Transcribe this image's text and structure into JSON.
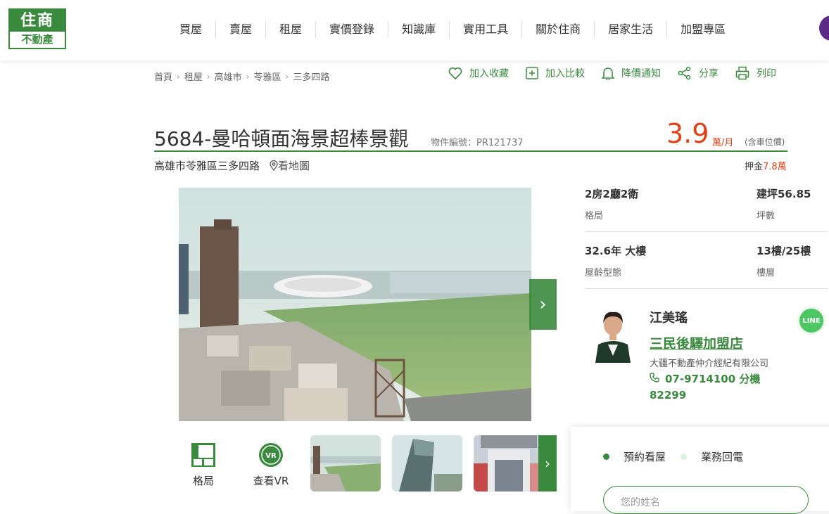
{
  "logo": {
    "top": "住商",
    "bottom": "不動產"
  },
  "nav": [
    "買屋",
    "賣屋",
    "租屋",
    "實價登錄",
    "知識庫",
    "實用工具",
    "關於住商",
    "居家生活",
    "加盟專區"
  ],
  "breadcrumb": [
    "首頁",
    "租屋",
    "高雄市",
    "苓雅區",
    "三多四路"
  ],
  "actions": {
    "favorite": "加入收藏",
    "compare": "加入比較",
    "notify": "降價通知",
    "share": "分享",
    "print": "列印"
  },
  "listing": {
    "title": "5684-曼哈頓面海景超棒景觀",
    "item_no": "物件編號：PR121737",
    "price": "3.9",
    "price_unit": "萬/月",
    "price_note": "(含車位價)",
    "address": "高雄市苓雅區三多四路",
    "map_link": "看地圖",
    "deposit_label": "押金",
    "deposit_value": "7.8萬"
  },
  "specs": {
    "layout_value": "2房2廳2衛",
    "layout_label": "格局",
    "area_value": "建坪56.85",
    "area_label": "坪數",
    "age_value": "32.6年 大樓",
    "age_label": "屋齡型態",
    "floor_value": "13樓/25樓",
    "floor_label": "樓層"
  },
  "tools": {
    "floorplan": "格局",
    "vr": "查看VR",
    "vr_badge": "VR"
  },
  "agent": {
    "name": "江美瑤",
    "store": "三民後驛加盟店",
    "company": "大疆不動產仲介經紀有限公司",
    "phone": "07-9714100 分機 82299",
    "line": "LINE"
  },
  "contact": {
    "tab_viewing": "預約看屋",
    "tab_callback": "業務回電",
    "name_placeholder": "您的姓名"
  },
  "colors": {
    "brand_green": "#3a8a3e",
    "price_red": "#e0411b",
    "accent_purple": "#5b2b86"
  }
}
